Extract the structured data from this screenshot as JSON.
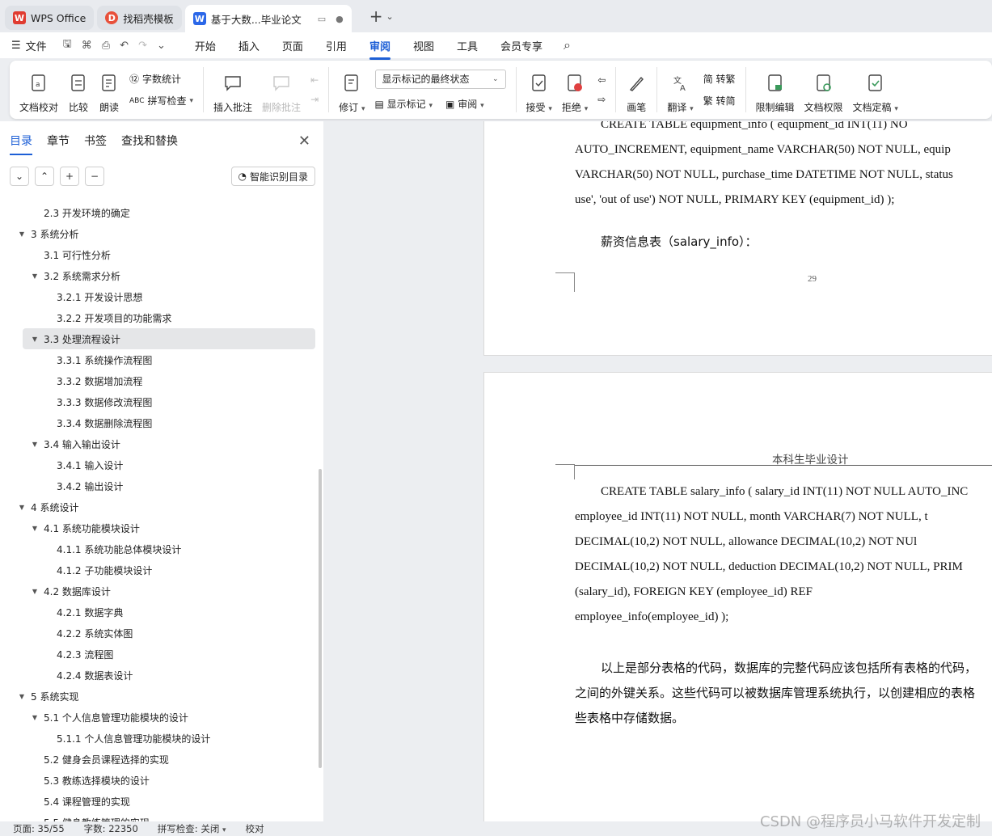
{
  "tabs": [
    {
      "label": "WPS Office"
    },
    {
      "label": "找稻壳模板"
    },
    {
      "label": "基于大数...毕业论文"
    }
  ],
  "menu": {
    "file": "文件",
    "items": [
      "开始",
      "插入",
      "页面",
      "引用",
      "审阅",
      "视图",
      "工具",
      "会员专享"
    ],
    "active": "审阅"
  },
  "ribbon": {
    "doc_check": "文档校对",
    "compare": "比较",
    "read_aloud": "朗读",
    "word_count": "字数统计",
    "spell_check": "拼写检查",
    "insert_comment": "插入批注",
    "delete_comment": "删除批注",
    "revise": "修订",
    "markup_state": "显示标记的最终状态",
    "show_markup": "显示标记",
    "review": "审阅",
    "accept": "接受",
    "reject": "拒绝",
    "pen": "画笔",
    "translate": "翻译",
    "to_trad": "简 转繁",
    "to_simp": "繁 转简",
    "restrict": "限制编辑",
    "permission": "文档权限",
    "finalize": "文档定稿"
  },
  "sidebar": {
    "tabs": [
      "目录",
      "章节",
      "书签",
      "查找和替换"
    ],
    "smart_toc": "智能识别目录",
    "toc": [
      {
        "text": "2.3 开发环境的确定",
        "level": 2,
        "arrow": ""
      },
      {
        "text": "3  系统分析",
        "level": 1,
        "arrow": "down"
      },
      {
        "text": "3.1 可行性分析",
        "level": 2,
        "arrow": ""
      },
      {
        "text": "3.2  系统需求分析",
        "level": 2,
        "arrow": "down"
      },
      {
        "text": "3.2.1  开发设计思想",
        "level": 3,
        "arrow": ""
      },
      {
        "text": "3.2.2  开发项目的功能需求",
        "level": 3,
        "arrow": ""
      },
      {
        "text": "3.3 处理流程设计",
        "level": 2,
        "arrow": "down",
        "selected": true
      },
      {
        "text": "3.3.1 系统操作流程图",
        "level": 3,
        "arrow": ""
      },
      {
        "text": "3.3.2 数据增加流程",
        "level": 3,
        "arrow": ""
      },
      {
        "text": "3.3.3 数据修改流程图",
        "level": 3,
        "arrow": ""
      },
      {
        "text": "3.3.4 数据删除流程图",
        "level": 3,
        "arrow": ""
      },
      {
        "text": "3.4 输入输出设计",
        "level": 2,
        "arrow": "down"
      },
      {
        "text": "3.4.1 输入设计",
        "level": 3,
        "arrow": ""
      },
      {
        "text": "3.4.2 输出设计",
        "level": 3,
        "arrow": ""
      },
      {
        "text": "4  系统设计",
        "level": 1,
        "arrow": "down"
      },
      {
        "text": "4.1 系统功能模块设计",
        "level": 2,
        "arrow": "down"
      },
      {
        "text": "4.1.1 系统功能总体模块设计",
        "level": 3,
        "arrow": ""
      },
      {
        "text": "4.1.2 子功能模块设计",
        "level": 3,
        "arrow": ""
      },
      {
        "text": "4.2 数据库设计",
        "level": 2,
        "arrow": "down"
      },
      {
        "text": "4.2.1 数据字典",
        "level": 3,
        "arrow": ""
      },
      {
        "text": "4.2.2 系统实体图",
        "level": 3,
        "arrow": ""
      },
      {
        "text": "4.2.3 流程图",
        "level": 3,
        "arrow": ""
      },
      {
        "text": "4.2.4 数据表设计",
        "level": 3,
        "arrow": ""
      },
      {
        "text": "5  系统实现",
        "level": 1,
        "arrow": "down"
      },
      {
        "text": "5.1 个人信息管理功能模块的设计",
        "level": 2,
        "arrow": "down"
      },
      {
        "text": "5.1.1 个人信息管理功能模块的设计",
        "level": 3,
        "arrow": ""
      },
      {
        "text": "5.2 健身会员课程选择的实现",
        "level": 2,
        "arrow": ""
      },
      {
        "text": "5.3 教练选择模块的设计",
        "level": 2,
        "arrow": ""
      },
      {
        "text": "5.4 课程管理的实现",
        "level": 2,
        "arrow": ""
      },
      {
        "text": "5.5 健身教练管理的实现",
        "level": 2,
        "arrow": ""
      }
    ]
  },
  "doc": {
    "page1_lines": [
      "CREATE   TABLE   equipment_info   (   equipment_id   INT(11)   NO",
      "AUTO_INCREMENT, equipment_name VARCHAR(50) NOT NULL, equip",
      "VARCHAR(50) NOT NULL, purchase_time DATETIME NOT NULL, status",
      "use', 'out of use') NOT NULL, PRIMARY KEY (equipment_id) );"
    ],
    "salary_heading": "薪资信息表（salary_info）：",
    "page_number": "29",
    "page2_header": "本科生毕业设计",
    "page2_lines": [
      "CREATE TABLE salary_info ( salary_id INT(11) NOT NULL AUTO_INC",
      "employee_id  INT(11)  NOT  NULL,  month  VARCHAR(7)  NOT  NULL,  t",
      "DECIMAL(10,2)   NOT   NULL,   allowance   DECIMAL(10,2)   NOT   NUl",
      "DECIMAL(10,2) NOT NULL, deduction DECIMAL(10,2) NOT NULL, PRIM",
      "(salary_id),        FOREIGN        KEY        (employee_id)        REF",
      "employee_info(employee_id) );"
    ],
    "para_lines": [
      "以上是部分表格的代码，数据库的完整代码应该包括所有表格的代码，",
      "之间的外键关系。这些代码可以被数据库管理系统执行，以创建相应的表格",
      "些表格中存储数据。"
    ]
  },
  "status": {
    "page": "页面: 35/55",
    "words": "字数: 22350",
    "spell": "拼写检查: 关闭",
    "proof": "校对"
  },
  "watermark": "CSDN @程序员小马软件开发定制"
}
